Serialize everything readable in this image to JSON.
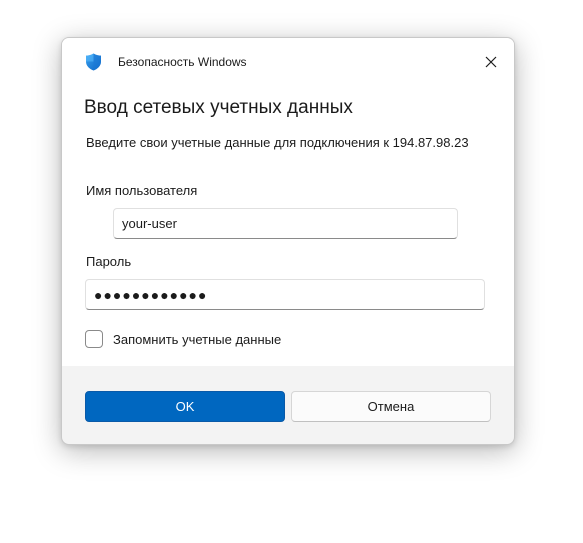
{
  "window": {
    "app_title": "Безопасность Windows",
    "close_icon": "close-icon",
    "shield_icon": "shield-icon"
  },
  "dialog": {
    "heading": "Ввод сетевых учетных данных",
    "description": "Введите свои учетные данные для подключения к 194.87.98.23"
  },
  "fields": {
    "username_label": "Имя пользователя",
    "username_value": "your-user",
    "password_label": "Пароль",
    "password_value": "●●●●●●●●●●●●"
  },
  "remember": {
    "label": "Запомнить учетные данные",
    "checked": false
  },
  "buttons": {
    "ok_label": "OK",
    "cancel_label": "Отмена"
  },
  "colors": {
    "accent": "#0067c0",
    "footer_bg": "#f3f3f3",
    "content_bg": "#ffffff"
  }
}
